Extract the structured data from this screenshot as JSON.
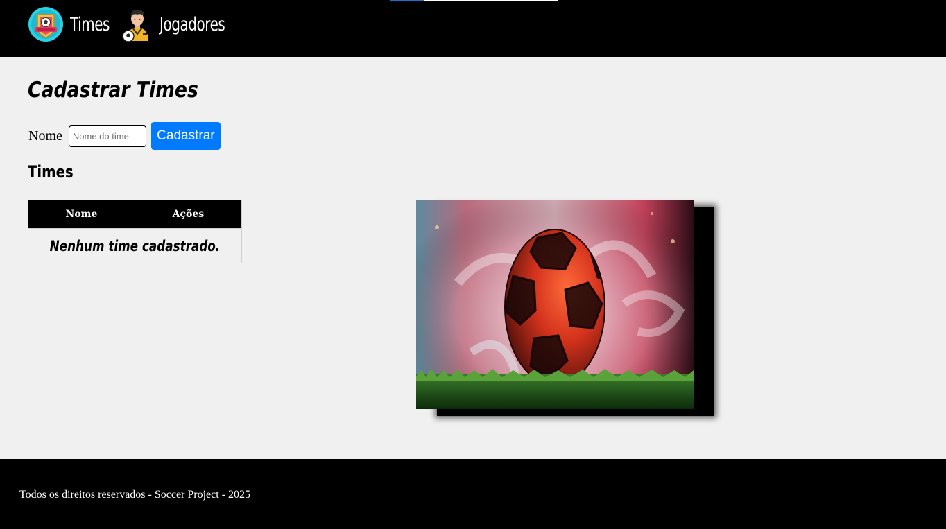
{
  "header": {
    "nav": [
      {
        "label": "Times",
        "icon": "soccer-badge-icon"
      },
      {
        "label": "Jogadores",
        "icon": "player-icon"
      }
    ]
  },
  "main": {
    "title": "Cadastrar Times",
    "form": {
      "label": "Nome",
      "input_value": "",
      "placeholder": "Nome do time",
      "submit_label": "Cadastrar"
    },
    "section_title": "Times",
    "table": {
      "columns": [
        "Nome",
        "Ações"
      ],
      "empty_message": "Nenhum time cadastrado."
    },
    "hero_image": {
      "subject": "soccer-ball-on-grass"
    }
  },
  "footer": {
    "text": "Todos os direitos reservados - Soccer Project - 2025"
  },
  "colors": {
    "header_bg": "#000000",
    "page_bg": "#f0f0f0",
    "button_bg": "#007bff",
    "footer_bg": "#000000"
  }
}
